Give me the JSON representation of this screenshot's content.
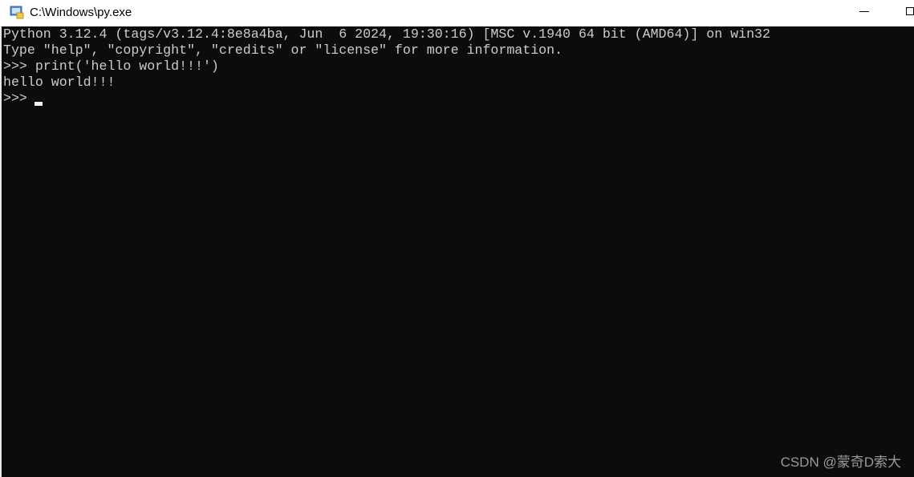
{
  "window": {
    "title": "C:\\Windows\\py.exe",
    "icon": "python-console-icon"
  },
  "console": {
    "lines": [
      "Python 3.12.4 (tags/v3.12.4:8e8a4ba, Jun  6 2024, 19:30:16) [MSC v.1940 64 bit (AMD64)] on win32",
      "Type \"help\", \"copyright\", \"credits\" or \"license\" for more information.",
      ">>> print('hello world!!!')",
      "hello world!!!",
      ">>> "
    ]
  },
  "watermark": "CSDN @蒙奇D索大",
  "colors": {
    "background": "#0c0c0c",
    "text": "#cccccc"
  }
}
